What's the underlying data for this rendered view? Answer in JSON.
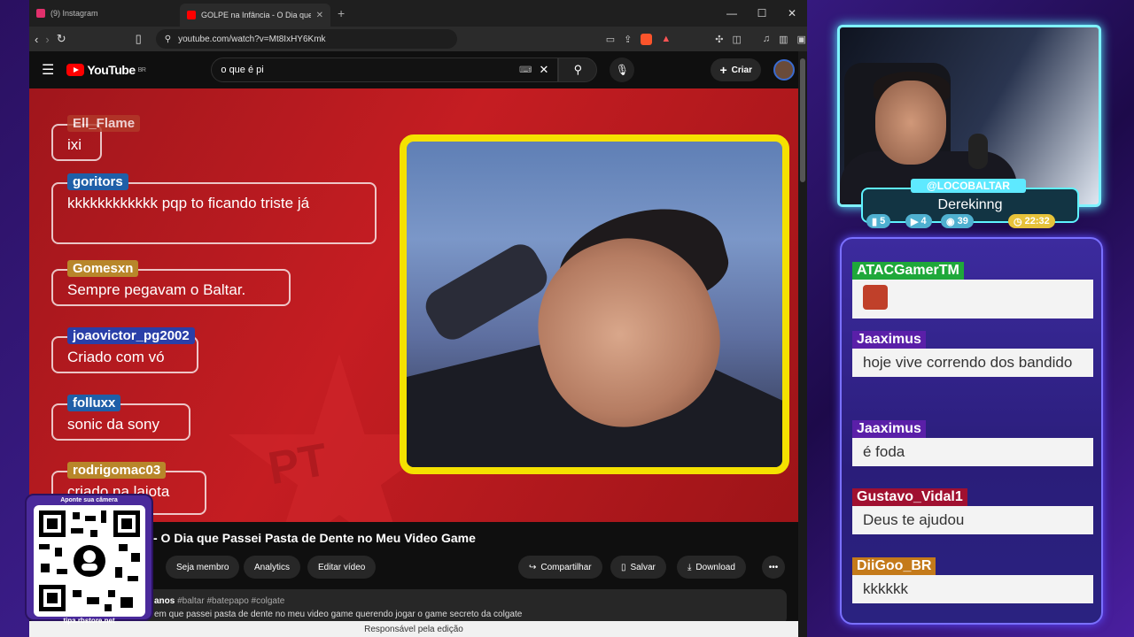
{
  "browser": {
    "tabs": [
      {
        "label": "(9) Instagram",
        "active": false,
        "color": "#e1306c"
      },
      {
        "label": "GOLPE na Infância - O Dia que Pas…",
        "active": true,
        "color": "#ff0000"
      }
    ],
    "url": "youtube.com/watch?v=Mt8IxHY6Kmk",
    "minimize": "—",
    "maximize": "☐",
    "close": "✕"
  },
  "youtube": {
    "logo": "YouTube",
    "region": "BR",
    "search_value": "o que é pi",
    "create_label": "Criar",
    "video_title": "- O Dia que Passei Pasta de Dente no Meu Video Game",
    "buttons": {
      "member": "Seja membro",
      "analytics": "Analytics",
      "edit": "Editar vídeo",
      "share": "Compartilhar",
      "save": "Salvar",
      "download": "Download",
      "more": "•••"
    },
    "description_meta": "anos",
    "description_tags": "#baltar #batepapo #colgate",
    "description_text": "em que passei pasta de dente no meu video game querendo jogar o game secreto da colgate",
    "status_text": "Responsável pela edição",
    "overlay_chat": [
      {
        "user": "Ell_Flame",
        "text": "ixi",
        "color": "#b23a2a"
      },
      {
        "user": "goritors",
        "text": "kkkkkkkkkkkk pqp to ficando triste já",
        "color": "#1f5fa8"
      },
      {
        "user": "Gomesxn",
        "text": "Sempre pegavam o Baltar.",
        "color": "#b8862a"
      },
      {
        "user": "joaovictor_pg2002",
        "text": "Criado com vó",
        "color": "#2a3fa8"
      },
      {
        "user": "folluxx",
        "text": "sonic da sony",
        "color": "#1f5fa8"
      },
      {
        "user": "rodrigomac03",
        "text": "criado na lajota",
        "color": "#b8862a"
      }
    ],
    "pt_text": "PT"
  },
  "qr": {
    "caption": "Aponte sua câmera",
    "url": "tipa.rbstore.net"
  },
  "streamer": {
    "handle": "@LOCOBALTAR",
    "name": "Derekinng",
    "stats": [
      {
        "icon": "twitch-icon",
        "value": "5",
        "color": "#4fb0d0"
      },
      {
        "icon": "youtube-icon",
        "value": "4",
        "color": "#4fb0d0"
      },
      {
        "icon": "viewers-icon",
        "value": "39",
        "color": "#4fb0d0"
      },
      {
        "icon": "clock-icon",
        "value": "22:32",
        "color": "#e7c23a"
      }
    ]
  },
  "side_chat": [
    {
      "user": "ATACGamerTM",
      "text": "",
      "color": "#1fa83a",
      "emote": true
    },
    {
      "user": "Jaaximus",
      "text": "hoje vive correndo dos bandido",
      "color": "#5a1fa8"
    },
    {
      "user": "Jaaximus",
      "text": "é foda",
      "color": "#5a1fa8"
    },
    {
      "user": "Gustavo_Vidal1",
      "text": "Deus te ajudou",
      "color": "#a01030"
    },
    {
      "user": "DiiGoo_BR",
      "text": "kkkkkk",
      "color": "#c47a1a"
    }
  ]
}
